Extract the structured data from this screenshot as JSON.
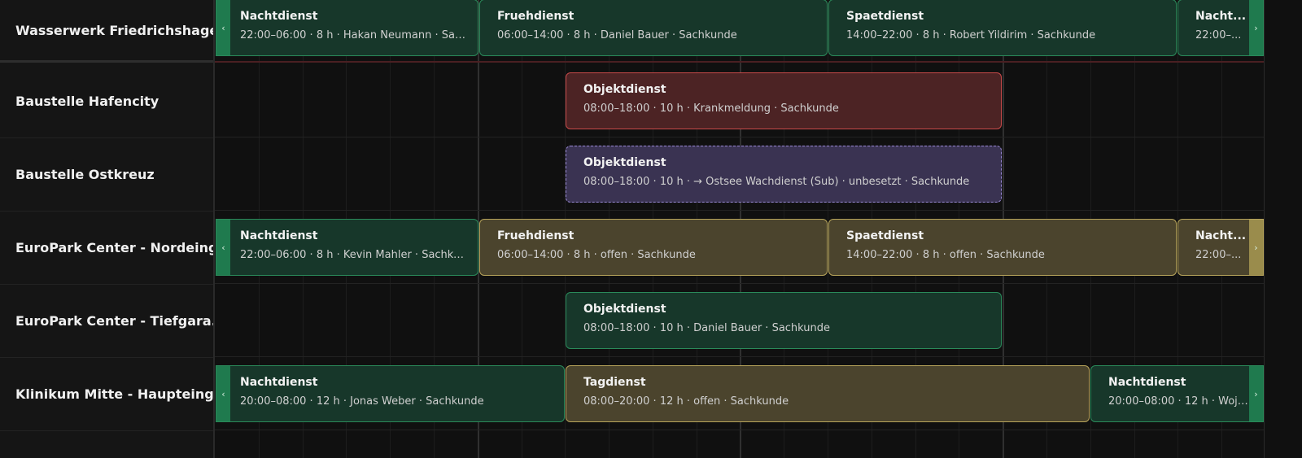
{
  "rows": [
    {
      "label": "Wasserwerk Friedrichshagen"
    },
    {
      "label": "Baustelle Hafencity"
    },
    {
      "label": "Baustelle Ostkreuz"
    },
    {
      "label": "EuroPark Center - Nordeing..."
    },
    {
      "label": "EuroPark Center - Tiefgara..."
    },
    {
      "label": "Klinikum Mitte - Haupteing..."
    }
  ],
  "shifts": [
    {
      "title": "Nachtdienst",
      "meta": "22:00–06:00 · 8 h · Hakan Neumann · Sac..."
    },
    {
      "title": "Fruehdienst",
      "meta": "06:00–14:00 · 8 h · Daniel Bauer · Sachkunde"
    },
    {
      "title": "Spaetdienst",
      "meta": "14:00–22:00 · 8 h · Robert Yildirim · Sachkunde"
    },
    {
      "title": "Nacht...",
      "meta": "22:00–..."
    },
    {
      "title": "Objektdienst",
      "meta": "08:00–18:00 · 10 h · Krankmeldung · Sachkunde"
    },
    {
      "title": "Objektdienst",
      "meta": "08:00–18:00 · 10 h · → Ostsee Wachdienst (Sub) · unbesetzt · Sachkunde"
    },
    {
      "title": "Nachtdienst",
      "meta": "22:00–06:00 · 8 h · Kevin Mahler · Sachku..."
    },
    {
      "title": "Fruehdienst",
      "meta": "06:00–14:00 · 8 h · offen · Sachkunde"
    },
    {
      "title": "Spaetdienst",
      "meta": "14:00–22:00 · 8 h · offen · Sachkunde"
    },
    {
      "title": "Nacht...",
      "meta": "22:00–..."
    },
    {
      "title": "Objektdienst",
      "meta": "08:00–18:00 · 10 h · Daniel Bauer · Sachkunde"
    },
    {
      "title": "Nachtdienst",
      "meta": "20:00–08:00 · 12 h · Jonas Weber · Sachkunde"
    },
    {
      "title": "Tagdienst",
      "meta": "08:00–20:00 · 12 h · offen · Sachkunde"
    },
    {
      "title": "Nachtdienst",
      "meta": "20:00–08:00 · 12 h · Wojc..."
    }
  ],
  "handles": {
    "left": "‹",
    "right": "›"
  },
  "colors": {
    "green": "#17372a",
    "yellow": "#4b442d",
    "red": "#4c2324",
    "purple": "#3a3352"
  }
}
